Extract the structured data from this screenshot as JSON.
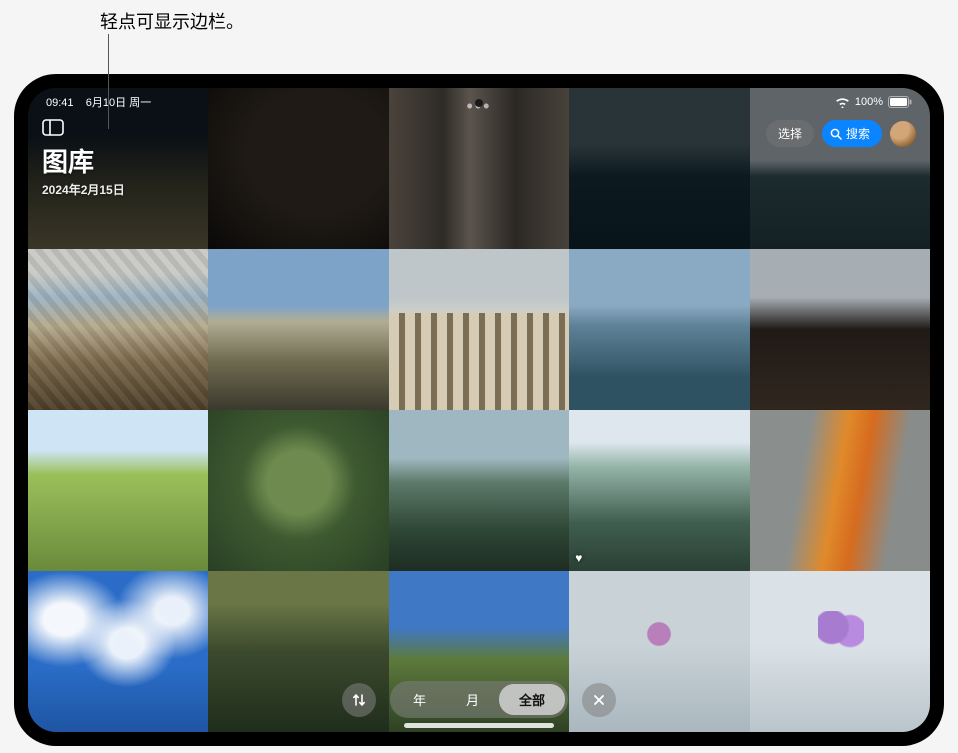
{
  "callout": {
    "text": "轻点可显示边栏。"
  },
  "statusBar": {
    "time": "09:41",
    "date": "6月10日 周一",
    "batteryPercent": "100%"
  },
  "header": {
    "title": "图库",
    "subtitle": "2024年2月15日",
    "selectLabel": "选择",
    "searchLabel": "搜索"
  },
  "segmented": {
    "year": "年",
    "month": "月",
    "all": "全部"
  }
}
